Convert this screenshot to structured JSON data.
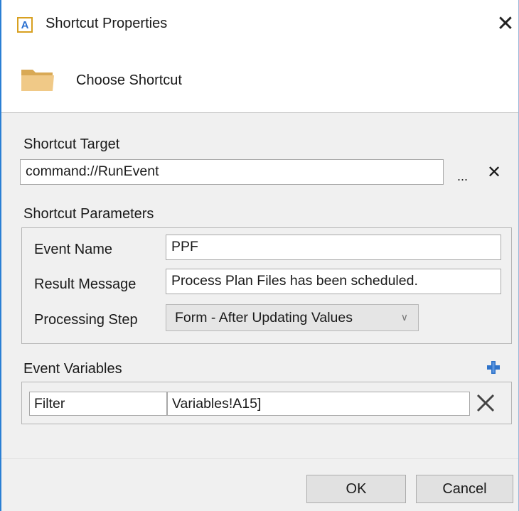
{
  "window": {
    "title": "Shortcut Properties",
    "app_icon_letter": "A",
    "subtitle": "Choose Shortcut"
  },
  "target": {
    "label": "Shortcut Target",
    "value": "command://RunEvent",
    "browse_label": "...",
    "clear_label": "✕"
  },
  "parameters": {
    "label": "Shortcut Parameters",
    "event_name_label": "Event Name",
    "event_name_value": "PPF",
    "result_message_label": "Result Message",
    "result_message_value": "Process Plan Files has been scheduled.",
    "processing_step_label": "Processing Step",
    "processing_step_value": "Form - After Updating Values"
  },
  "variables": {
    "label": "Event Variables",
    "rows": [
      {
        "name": "Filter",
        "value": "Variables!A15]"
      }
    ]
  },
  "buttons": {
    "ok": "OK",
    "cancel": "Cancel"
  },
  "colors": {
    "accent": "#2a7fd4",
    "folder": "#e8c07a",
    "plus": "#2f73c9"
  },
  "icons": [
    "app-icon",
    "close-icon",
    "folder-icon",
    "ellipsis-icon",
    "clear-icon",
    "chevron-down-icon",
    "plus-icon",
    "delete-row-icon"
  ]
}
